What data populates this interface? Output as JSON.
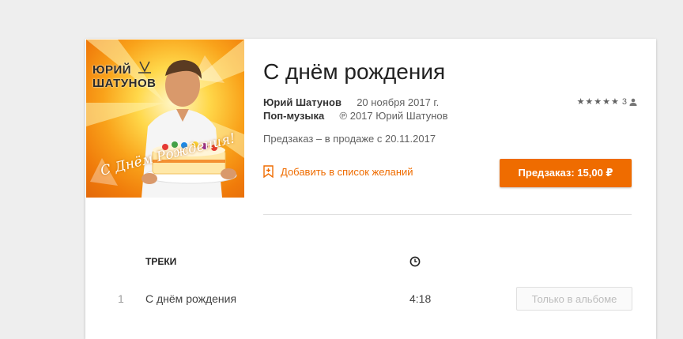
{
  "album": {
    "title": "С днём рождения",
    "artist": "Юрий Шатунов",
    "release_date": "20 ноября 2017 г.",
    "genre": "Поп-музыка",
    "copyright": "℗ 2017 Юрий Шатунов",
    "rating_stars": 5,
    "rating_count": "3",
    "preorder_note": "Предзаказ – в продаже с 20.11.2017",
    "wishlist_label": "Добавить в список желаний",
    "buy_label": "Предзаказ: 15,00 ₽",
    "cover": {
      "artist_line1": "ЮРИЙ",
      "artist_line2": "ШАТУНОВ",
      "script_text": "С Днём Рождения!"
    }
  },
  "tracks": {
    "header_label": "ТРЕКИ",
    "rows": [
      {
        "number": "1",
        "name": "С днём рождения",
        "duration": "4:18",
        "action_label": "Только в альбоме"
      }
    ]
  },
  "colors": {
    "accent": "#ef6c00",
    "background": "#eeeeee",
    "card": "#ffffff"
  }
}
